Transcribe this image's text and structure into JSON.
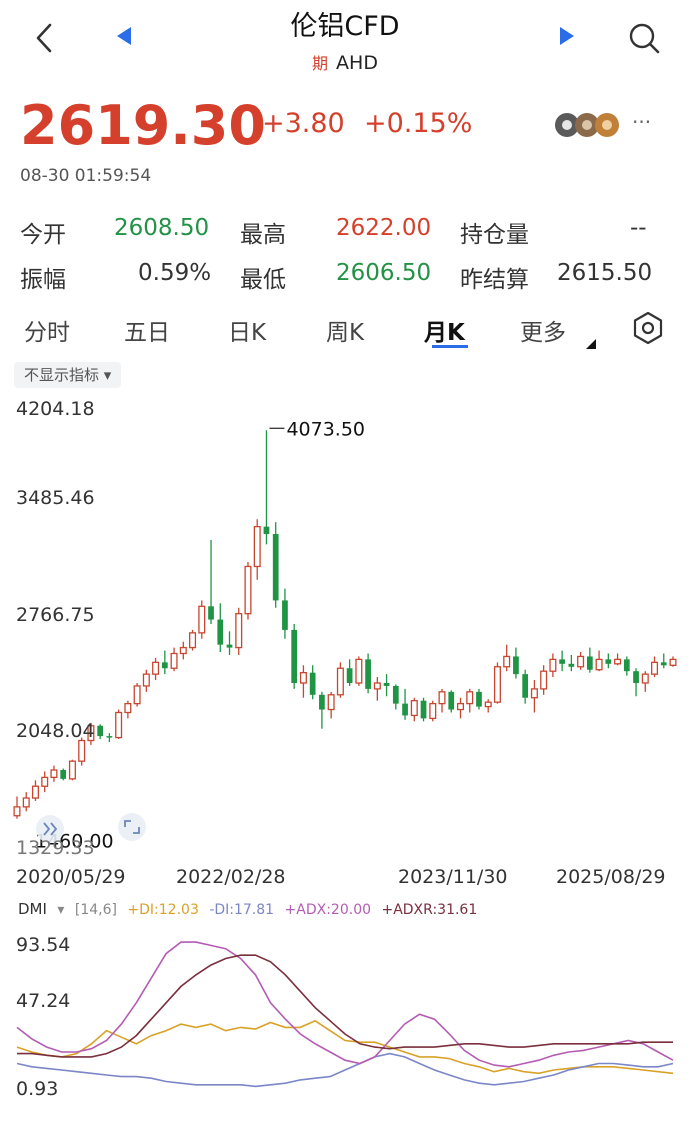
{
  "header": {
    "title": "伦铝CFD",
    "futures_tag": "期",
    "subtitle": "AHD"
  },
  "quote": {
    "price": "2619.30",
    "change": "+3.80",
    "change_pct": "+0.15%",
    "time": "08-30 01:59:54",
    "more": "···"
  },
  "stats": {
    "open_label": "今开",
    "open_value": "2608.50",
    "high_label": "最高",
    "high_value": "2622.00",
    "oi_label": "持仓量",
    "oi_value": "--",
    "amp_label": "振幅",
    "amp_value": "0.59%",
    "low_label": "最低",
    "low_value": "2606.50",
    "prev_label": "昨结算",
    "prev_value": "2615.50"
  },
  "tabs": [
    "分时",
    "五日",
    "日K",
    "周K",
    "月K",
    "更多"
  ],
  "indicator_pill": "不显示指标 ▾",
  "chart_data": [
    {
      "type": "candlestick",
      "y_ticks": [
        "4204.18",
        "3485.46",
        "2766.75",
        "2048.04",
        "1329.33"
      ],
      "x_ticks": [
        "2020/05/29",
        "2022/02/28",
        "2023/11/30",
        "2025/08/29"
      ],
      "ylim": [
        1329.33,
        4204.18
      ],
      "max_label": "4073.50",
      "min_label": "1460.00",
      "colors": {
        "up": "#c8462f",
        "down": "#1f9444"
      },
      "candles": [
        [
          1460,
          1590,
          1440,
          1520
        ],
        [
          1520,
          1620,
          1490,
          1580
        ],
        [
          1580,
          1700,
          1560,
          1660
        ],
        [
          1660,
          1760,
          1620,
          1720
        ],
        [
          1720,
          1800,
          1690,
          1770
        ],
        [
          1770,
          1780,
          1700,
          1710
        ],
        [
          1710,
          1840,
          1700,
          1830
        ],
        [
          1830,
          1990,
          1800,
          1970
        ],
        [
          1970,
          2090,
          1940,
          2070
        ],
        [
          2070,
          2080,
          1980,
          2000
        ],
        [
          2000,
          2020,
          1960,
          1990
        ],
        [
          1990,
          2180,
          1980,
          2160
        ],
        [
          2160,
          2240,
          2120,
          2220
        ],
        [
          2220,
          2360,
          2200,
          2340
        ],
        [
          2340,
          2450,
          2300,
          2420
        ],
        [
          2420,
          2530,
          2380,
          2500
        ],
        [
          2500,
          2580,
          2420,
          2460
        ],
        [
          2460,
          2600,
          2440,
          2560
        ],
        [
          2560,
          2640,
          2520,
          2600
        ],
        [
          2600,
          2720,
          2580,
          2700
        ],
        [
          2700,
          2920,
          2660,
          2880
        ],
        [
          2880,
          3330,
          2760,
          2790
        ],
        [
          2790,
          2900,
          2570,
          2620
        ],
        [
          2620,
          2710,
          2550,
          2600
        ],
        [
          2600,
          2870,
          2550,
          2830
        ],
        [
          2830,
          3180,
          2790,
          3150
        ],
        [
          3150,
          3470,
          3060,
          3420
        ],
        [
          3420,
          4073.5,
          3300,
          3370
        ],
        [
          3370,
          3450,
          2870,
          2920
        ],
        [
          2920,
          3000,
          2660,
          2720
        ],
        [
          2720,
          2760,
          2320,
          2360
        ],
        [
          2360,
          2480,
          2260,
          2430
        ],
        [
          2430,
          2480,
          2250,
          2280
        ],
        [
          2280,
          2300,
          2050,
          2180
        ],
        [
          2180,
          2300,
          2120,
          2280
        ],
        [
          2280,
          2500,
          2260,
          2460
        ],
        [
          2460,
          2520,
          2340,
          2360
        ],
        [
          2360,
          2540,
          2340,
          2520
        ],
        [
          2520,
          2560,
          2290,
          2320
        ],
        [
          2320,
          2400,
          2240,
          2360
        ],
        [
          2360,
          2420,
          2270,
          2340
        ],
        [
          2340,
          2350,
          2180,
          2220
        ],
        [
          2220,
          2320,
          2110,
          2140
        ],
        [
          2140,
          2260,
          2100,
          2240
        ],
        [
          2240,
          2260,
          2100,
          2120
        ],
        [
          2120,
          2240,
          2100,
          2220
        ],
        [
          2220,
          2320,
          2160,
          2300
        ],
        [
          2300,
          2310,
          2160,
          2180
        ],
        [
          2180,
          2260,
          2120,
          2220
        ],
        [
          2220,
          2320,
          2160,
          2300
        ],
        [
          2300,
          2320,
          2180,
          2200
        ],
        [
          2200,
          2250,
          2160,
          2230
        ],
        [
          2230,
          2500,
          2220,
          2470
        ],
        [
          2470,
          2620,
          2440,
          2540
        ],
        [
          2540,
          2600,
          2390,
          2420
        ],
        [
          2420,
          2450,
          2220,
          2260
        ],
        [
          2260,
          2380,
          2160,
          2320
        ],
        [
          2320,
          2480,
          2280,
          2440
        ],
        [
          2440,
          2560,
          2400,
          2520
        ],
        [
          2520,
          2580,
          2440,
          2490
        ],
        [
          2490,
          2550,
          2440,
          2470
        ],
        [
          2470,
          2570,
          2450,
          2540
        ],
        [
          2540,
          2600,
          2430,
          2450
        ],
        [
          2450,
          2580,
          2440,
          2520
        ],
        [
          2520,
          2560,
          2460,
          2490
        ],
        [
          2490,
          2560,
          2480,
          2520
        ],
        [
          2520,
          2540,
          2410,
          2440
        ],
        [
          2440,
          2460,
          2270,
          2360
        ],
        [
          2360,
          2440,
          2300,
          2420
        ],
        [
          2420,
          2540,
          2400,
          2500
        ],
        [
          2500,
          2560,
          2460,
          2480
        ],
        [
          2480,
          2540,
          2470,
          2520
        ]
      ]
    },
    {
      "type": "line",
      "indicator": "DMI",
      "params": "[14,6]",
      "y_ticks": [
        "93.54",
        "47.24",
        "0.93"
      ],
      "ylim": [
        0.93,
        93.54
      ],
      "series": [
        {
          "name": "+DI",
          "label": "+DI:12.03",
          "color": "#d9a227",
          "values": [
            28,
            25,
            23,
            22,
            24,
            30,
            38,
            34,
            30,
            35,
            38,
            42,
            40,
            42,
            38,
            40,
            39,
            43,
            40,
            40,
            44,
            38,
            32,
            31,
            31,
            28,
            25,
            22,
            22,
            21,
            18,
            16,
            13,
            15,
            13,
            12,
            14,
            15,
            16,
            16,
            16,
            15,
            14,
            13,
            12
          ]
        },
        {
          "name": "-DI",
          "label": "-DI:17.81",
          "color": "#7b86c8",
          "values": [
            18,
            16,
            15,
            14,
            13,
            12,
            11,
            10,
            10,
            9,
            7,
            6,
            5,
            5,
            5,
            5,
            4,
            5,
            6,
            8,
            9,
            10,
            14,
            18,
            22,
            24,
            22,
            18,
            14,
            11,
            8,
            6,
            5,
            6,
            7,
            9,
            11,
            14,
            16,
            18,
            18,
            17,
            16,
            16,
            18
          ]
        },
        {
          "name": "+ADX",
          "label": "+ADX:20.00",
          "color": "#b45cb3",
          "values": [
            40,
            33,
            28,
            25,
            25,
            27,
            32,
            42,
            55,
            70,
            85,
            92,
            92,
            90,
            88,
            82,
            72,
            55,
            45,
            36,
            30,
            25,
            20,
            18,
            22,
            32,
            42,
            48,
            45,
            36,
            26,
            20,
            17,
            16,
            18,
            20,
            23,
            25,
            26,
            28,
            30,
            32,
            30,
            25,
            20
          ]
        },
        {
          "name": "+ADXR",
          "label": "+ADXR:31.61",
          "color": "#7a2f3d",
          "values": [
            24,
            24,
            23,
            22,
            22,
            22,
            24,
            28,
            35,
            45,
            55,
            65,
            72,
            78,
            82,
            84,
            84,
            80,
            72,
            62,
            52,
            44,
            36,
            30,
            28,
            27,
            28,
            28,
            28,
            29,
            30,
            30,
            29,
            28,
            28,
            29,
            30,
            30,
            30,
            30,
            30,
            30,
            31,
            31,
            31
          ]
        }
      ]
    }
  ],
  "colors": {
    "up": "#d4402c",
    "down": "#239146",
    "accent": "#2b6de8"
  }
}
